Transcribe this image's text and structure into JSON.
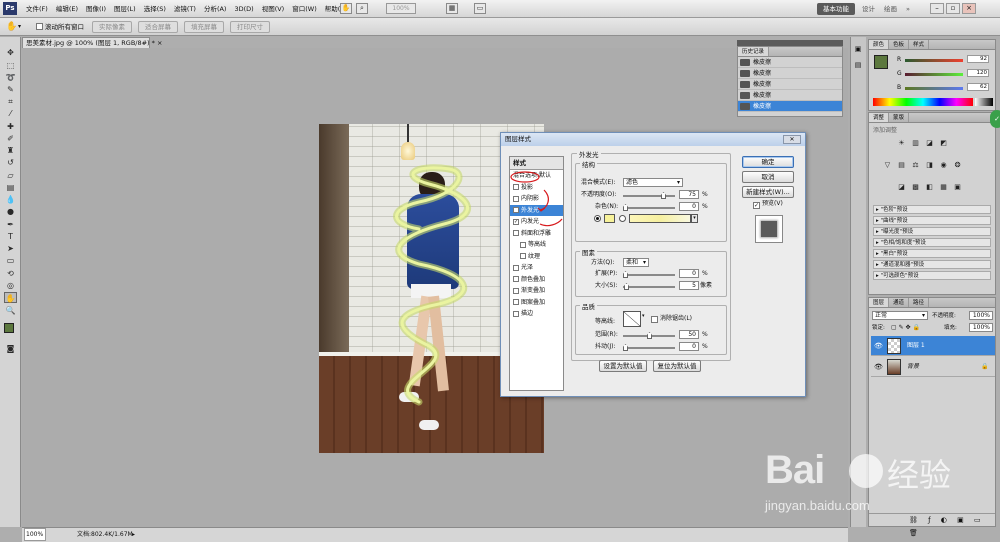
{
  "app": {
    "logo": "Ps"
  },
  "menubar": {
    "items": [
      "文件(F)",
      "编辑(E)",
      "图像(I)",
      "图层(L)",
      "选择(S)",
      "滤镜(T)",
      "分析(A)",
      "3D(D)",
      "视图(V)",
      "窗口(W)",
      "帮助(H)"
    ],
    "zoom": "100%",
    "workspace_active": "基本功能",
    "workspace_links": [
      "设计",
      "绘画"
    ],
    "more": "»"
  },
  "options": {
    "scroll_all_label": "滚动所有窗口",
    "buttons": [
      "实际像素",
      "适合屏幕",
      "填充屏幕",
      "打印尺寸"
    ]
  },
  "document": {
    "tab_title": "思美素材.jpg @ 100% (图层 1, RGB/8#) *",
    "tab_close": "×"
  },
  "status": {
    "zoom": "100%",
    "doc_info": "文档:802.4K/1.67M"
  },
  "dialog": {
    "title": "图层样式",
    "close": "✕",
    "list_header": "样式",
    "list": [
      {
        "label": "混合选项:默认",
        "check": false,
        "indent": false,
        "sel": false
      },
      {
        "label": "投影",
        "check": true,
        "checked": false,
        "indent": false,
        "sel": false
      },
      {
        "label": "内阴影",
        "check": true,
        "checked": false,
        "indent": false,
        "sel": false
      },
      {
        "label": "外发光",
        "check": true,
        "checked": true,
        "indent": false,
        "sel": true
      },
      {
        "label": "内发光",
        "check": true,
        "checked": true,
        "indent": false,
        "sel": false
      },
      {
        "label": "斜面和浮雕",
        "check": true,
        "checked": false,
        "indent": false,
        "sel": false
      },
      {
        "label": "等高线",
        "check": true,
        "checked": false,
        "indent": true,
        "sel": false
      },
      {
        "label": "纹理",
        "check": true,
        "checked": false,
        "indent": true,
        "sel": false
      },
      {
        "label": "光泽",
        "check": true,
        "checked": false,
        "indent": false,
        "sel": false
      },
      {
        "label": "颜色叠加",
        "check": true,
        "checked": false,
        "indent": false,
        "sel": false
      },
      {
        "label": "渐变叠加",
        "check": true,
        "checked": false,
        "indent": false,
        "sel": false
      },
      {
        "label": "图案叠加",
        "check": true,
        "checked": false,
        "indent": false,
        "sel": false
      },
      {
        "label": "描边",
        "check": true,
        "checked": false,
        "indent": false,
        "sel": false
      }
    ],
    "section_title": "外发光",
    "structure": {
      "title": "结构",
      "blend_label": "混合模式(E):",
      "blend_value": "滤色",
      "opacity_label": "不透明度(O):",
      "opacity_value": "75",
      "noise_label": "杂色(N):",
      "noise_value": "0",
      "pct": "%"
    },
    "elements": {
      "title": "图素",
      "method_label": "方法(Q):",
      "method_value": "柔和",
      "spread_label": "扩展(P):",
      "spread_value": "0",
      "size_label": "大小(S):",
      "size_value": "5",
      "size_unit": "像素",
      "pct": "%"
    },
    "quality": {
      "title": "品质",
      "contour_label": "等高线:",
      "antialias_label": "消除锯齿(L)",
      "range_label": "范围(R):",
      "range_value": "50",
      "jitter_label": "抖动(J):",
      "jitter_value": "0",
      "pct": "%"
    },
    "set_default": "设置为默认值",
    "reset_default": "复位为默认值",
    "ok": "确定",
    "cancel": "取消",
    "new_style": "新建样式(W)...",
    "preview_label": "预览(V)",
    "glow_color": "#f7f29a"
  },
  "history": {
    "title": "历史记录",
    "items": [
      "橡皮擦",
      "橡皮擦",
      "橡皮擦",
      "橡皮擦",
      "橡皮擦"
    ]
  },
  "color_panel": {
    "tabs": [
      "颜色",
      "色板",
      "样式"
    ],
    "values": [
      "92",
      "120",
      "62"
    ],
    "foreground": "#5c783e"
  },
  "adjust_panel": {
    "tabs": [
      "调整",
      "蒙版"
    ],
    "title": "添加调整",
    "presets": [
      "\"色阶\"预设",
      "\"曲线\"预设",
      "\"曝光度\"预设",
      "\"色相/饱和度\"预设",
      "\"黑白\"预设",
      "\"通道混和器\"预设",
      "\"可选颜色\"预设"
    ]
  },
  "layers_panel": {
    "tabs": [
      "图层",
      "通道",
      "路径"
    ],
    "blend": "正常",
    "opacity_label": "不透明度:",
    "opacity": "100%",
    "lock_label": "锁定:",
    "fill_label": "填充:",
    "fill": "100%",
    "layers": [
      {
        "name": "图层 1",
        "selected": true
      },
      {
        "name": "背景",
        "selected": false
      }
    ]
  },
  "watermark": {
    "text": "Bai",
    "text2": "经验",
    "url": "jingyan.baidu.com"
  }
}
